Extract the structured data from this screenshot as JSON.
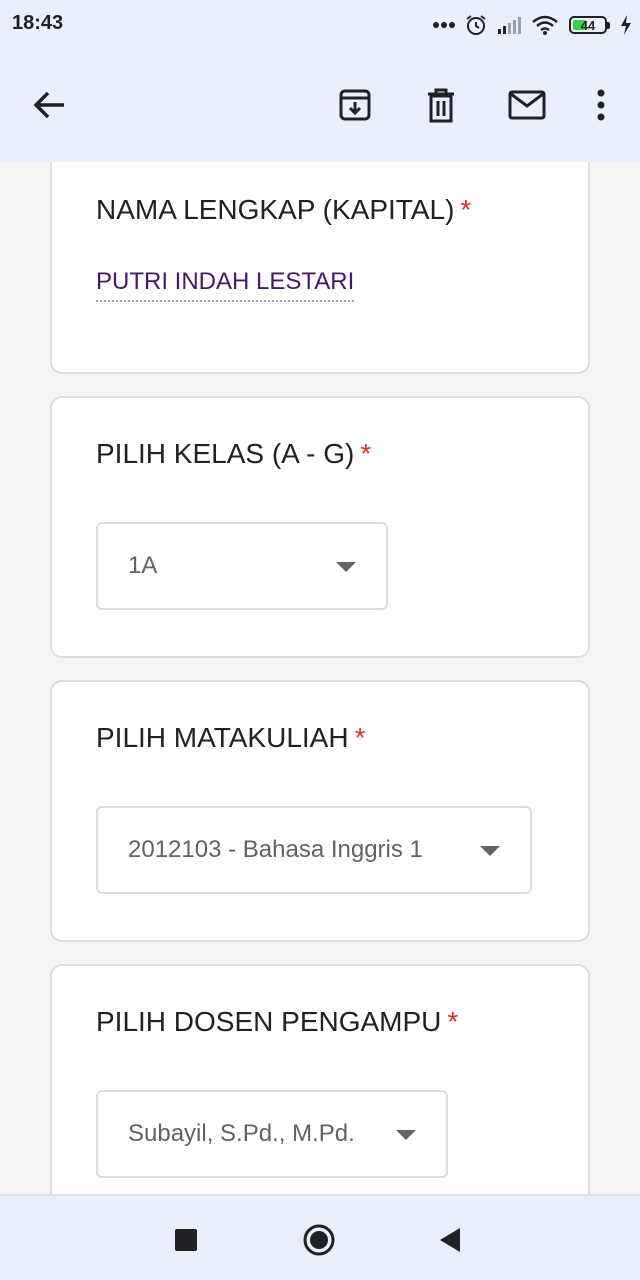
{
  "status_bar": {
    "time": "18:43",
    "battery": "44",
    "battery_level": 0.44,
    "icons": [
      "more-dots-icon",
      "alarm-icon",
      "signal-icon",
      "wifi-icon",
      "battery-icon",
      "charging-icon"
    ]
  },
  "app_bar": {
    "icons": [
      "back-arrow-icon",
      "archive-icon",
      "delete-icon",
      "mail-icon",
      "more-vert-icon"
    ]
  },
  "form": {
    "questions": [
      {
        "title": "NAMA LENGKAP (KAPITAL)",
        "required_mark": "*",
        "answer": "PUTRI INDAH LESTARI"
      },
      {
        "title": "PILIH KELAS (A - G)",
        "required_mark": "*",
        "selected": "1A"
      },
      {
        "title": "PILIH MATAKULIAH",
        "required_mark": "*",
        "selected": "2012103 - Bahasa Inggris 1"
      },
      {
        "title": "PILIH DOSEN PENGAMPU",
        "required_mark": "*",
        "selected": "Subayil, S.Pd., M.Pd."
      }
    ]
  },
  "nav_bar": {
    "icons": [
      "recents-square-icon",
      "home-circle-icon",
      "back-triangle-icon"
    ]
  },
  "colors": {
    "bar_background": "#eaf0fb",
    "page_background": "#f4f4f4",
    "required": "#d93025",
    "answer_text": "#4a1766",
    "battery_fill": "#3ccf4e"
  }
}
